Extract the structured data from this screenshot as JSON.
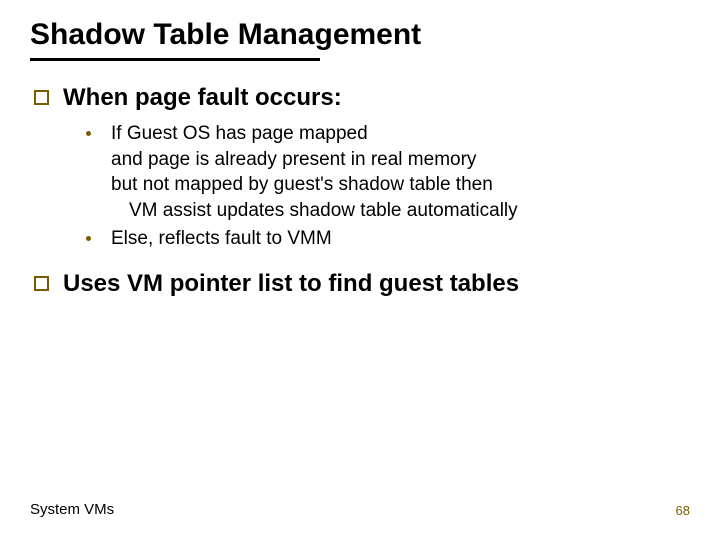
{
  "title": "Shadow Table Management",
  "points": [
    {
      "text": "When page fault occurs:",
      "sub": [
        {
          "lines": [
            {
              "text": "If Guest OS has page mapped",
              "indent": false
            },
            {
              "text": "and page is already present in real memory",
              "indent": false
            },
            {
              "text": "but not mapped by guest's shadow table then",
              "indent": false
            },
            {
              "text": "VM assist updates shadow table automatically",
              "indent": true
            }
          ]
        },
        {
          "lines": [
            {
              "text": "Else, reflects fault to VMM",
              "indent": false
            }
          ]
        }
      ]
    },
    {
      "text": "Uses VM pointer list to find guest tables",
      "sub": []
    }
  ],
  "footer": {
    "left": "System VMs",
    "right": "68"
  }
}
